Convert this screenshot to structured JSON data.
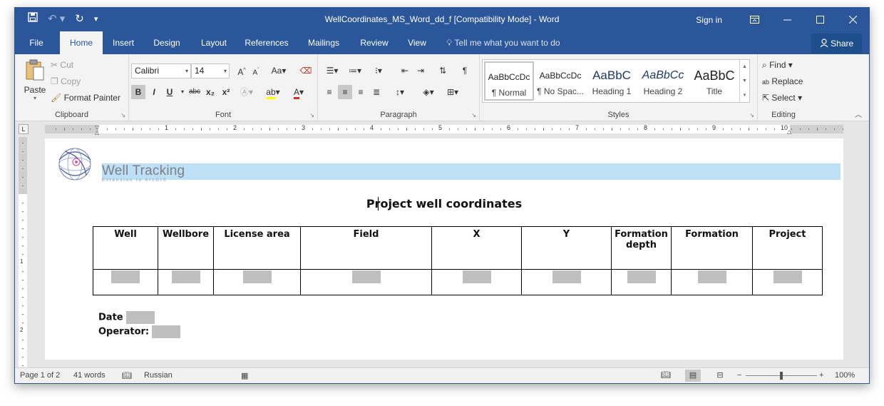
{
  "window": {
    "title": "WellCoordinates_MS_Word_dd_f [Compatibility Mode] - Word",
    "sign_in": "Sign in",
    "share": "Share"
  },
  "tabs": [
    "File",
    "Home",
    "Insert",
    "Design",
    "Layout",
    "References",
    "Mailings",
    "Review",
    "View"
  ],
  "active_tab": "Home",
  "tell_me": "Tell me what you want to do",
  "ribbon": {
    "clipboard": {
      "label": "Clipboard",
      "paste": "Paste",
      "cut": "Cut",
      "copy": "Copy",
      "format_painter": "Format Painter"
    },
    "font": {
      "label": "Font",
      "font_name": "Calibri",
      "font_size": "14",
      "bold": "B",
      "italic": "I",
      "underline": "U",
      "strike": "abc",
      "subscript": "x₂",
      "superscript": "x²",
      "aa": "Aa"
    },
    "paragraph": {
      "label": "Paragraph"
    },
    "styles": {
      "label": "Styles",
      "items": [
        {
          "sample": "AaBbCcDc",
          "name": "¶ Normal"
        },
        {
          "sample": "AaBbCcDc",
          "name": "¶ No Spac..."
        },
        {
          "sample": "AaBbC",
          "name": "Heading 1"
        },
        {
          "sample": "AaBbCc",
          "name": "Heading 2"
        },
        {
          "sample": "AaBbC",
          "name": "Title"
        }
      ]
    },
    "editing": {
      "label": "Editing",
      "find": "Find",
      "replace": "Replace",
      "select": "Select"
    }
  },
  "ruler": {
    "numbers": [
      "1",
      "2",
      "3",
      "4",
      "5",
      "6",
      "7",
      "8",
      "9",
      "10"
    ],
    "vertical_numbers": [
      "1",
      "2"
    ]
  },
  "document": {
    "logo_text": "Well Tracking",
    "logo_subtext": "Extension to ArcGIS",
    "title": "Project well coordinates",
    "table_headers": [
      "Well",
      "Wellbore",
      "License area",
      "Field",
      "X",
      "Y",
      "Formation depth",
      "Formation",
      "Project"
    ],
    "date_label": "Date",
    "operator_label": "Operator:"
  },
  "status": {
    "page": "Page 1 of 2",
    "words": "41 words",
    "language": "Russian",
    "zoom": "100%"
  },
  "colors": {
    "brand": "#2b579a",
    "logo_band": "#bde0f7"
  }
}
